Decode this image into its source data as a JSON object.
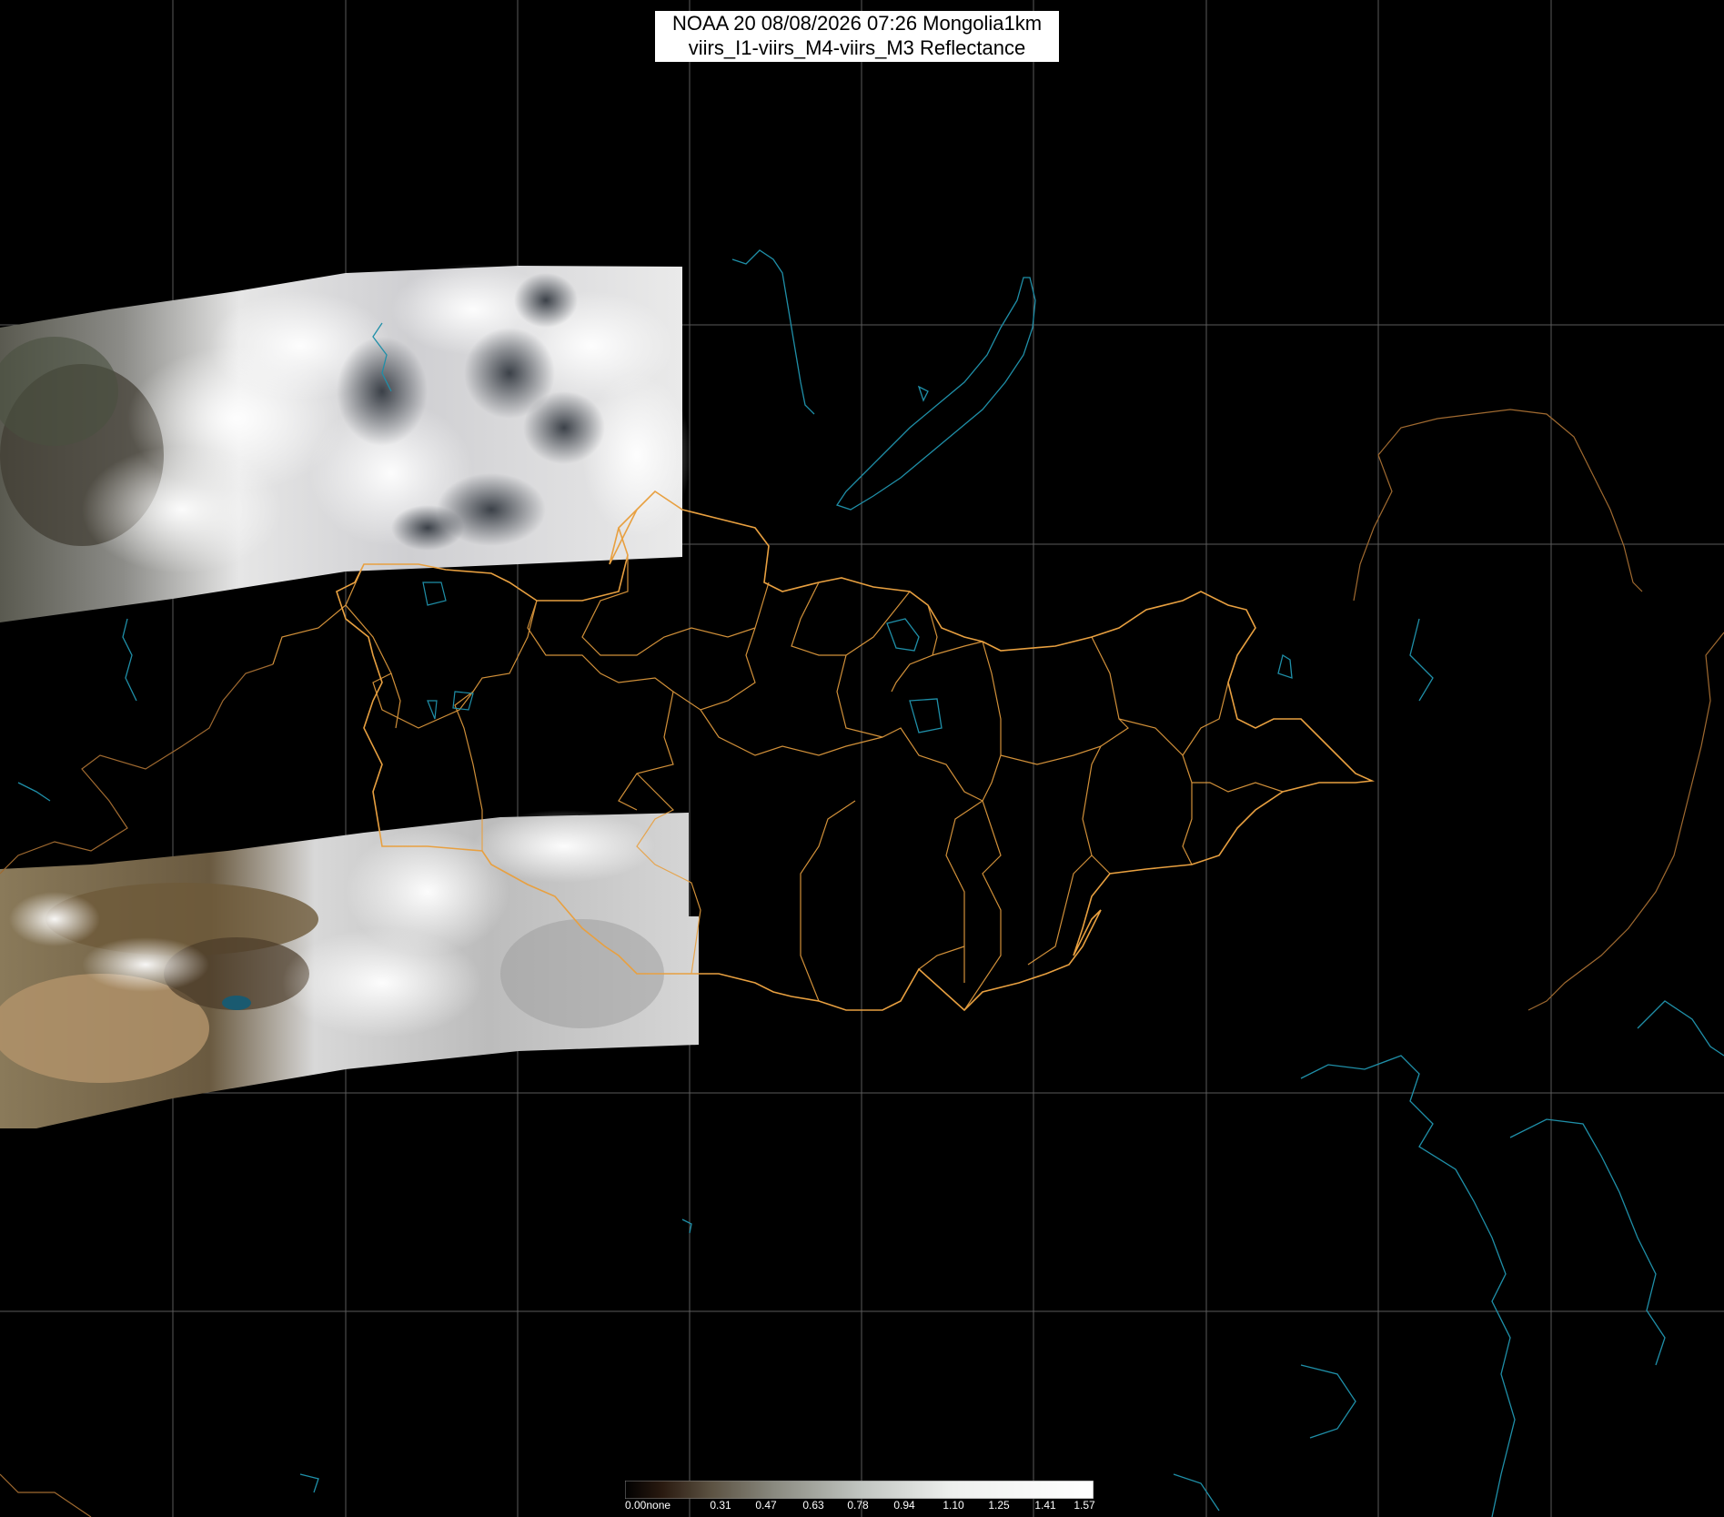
{
  "title": {
    "line1": "NOAA 20 08/08/2026 07:26 Mongolia1km",
    "line2": "viirs_I1-viirs_M4-viirs_M3 Reflectance"
  },
  "legend": {
    "ticks": [
      "0.00none",
      "0.31",
      "0.47",
      "0.63",
      "0.78",
      "0.94",
      "1.10",
      "1.25",
      "1.41",
      "1.57"
    ]
  },
  "colors": {
    "background": "#000000",
    "graticule": "#5a5a5a",
    "mongolia_aimag_borders": "#e8a040",
    "international_borders": "#a06a30",
    "coast_lakes": "#1f8fa8",
    "cloud": "#f0f0f0",
    "desert": "#a08a68"
  }
}
